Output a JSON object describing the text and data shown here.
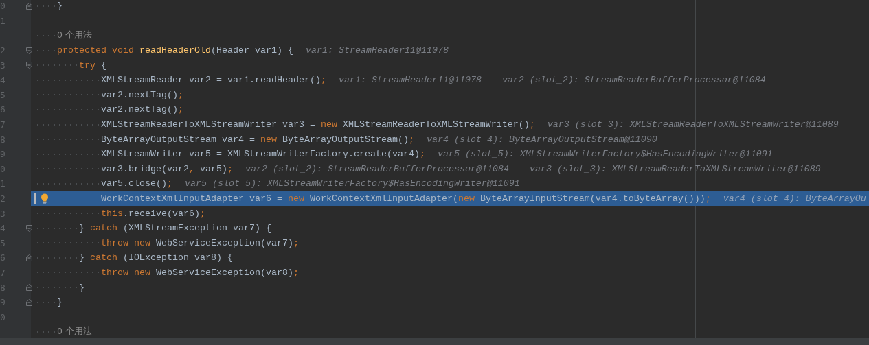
{
  "editor": {
    "rows": [
      {
        "kind": "code",
        "line_number": "0",
        "folding": {
          "kind": "end"
        },
        "current": false,
        "bulb": false,
        "indent": "    ",
        "tokens": [
          {
            "kind": "plain",
            "text": "}"
          }
        ]
      },
      {
        "kind": "code",
        "line_number": "1",
        "current": false,
        "bulb": false
      },
      {
        "kind": "usage_hint",
        "indent": "    ",
        "text": "0 个用法"
      },
      {
        "kind": "code",
        "line_number": "2",
        "folding": {
          "kind": "start"
        },
        "current": false,
        "bulb": false,
        "indent": "    ",
        "tokens": [
          {
            "kind": "keyword",
            "text": "protected"
          },
          {
            "kind": "keyword",
            "text": " void"
          },
          {
            "kind": "method",
            "text": " readHeaderOld"
          },
          {
            "kind": "plain",
            "text": "(Header var1) {"
          }
        ],
        "hints": [
          "var1: StreamHeader11@11078"
        ]
      },
      {
        "kind": "code",
        "line_number": "3",
        "folding": {
          "kind": "start"
        },
        "current": false,
        "bulb": false,
        "indent": "        ",
        "tokens": [
          {
            "kind": "keyword",
            "text": "try"
          },
          {
            "kind": "plain",
            "text": " {"
          }
        ]
      },
      {
        "kind": "code",
        "line_number": "4",
        "current": false,
        "bulb": false,
        "indent": "            ",
        "tokens": [
          {
            "kind": "plain",
            "text": "XMLStreamReader var2 = var1.readHeader()"
          },
          {
            "kind": "punct",
            "text": ";"
          }
        ],
        "hints": [
          "var1: StreamHeader11@11078",
          "var2 (slot_2): StreamReaderBufferProcessor@11084"
        ]
      },
      {
        "kind": "code",
        "line_number": "5",
        "current": false,
        "bulb": false,
        "indent": "            ",
        "tokens": [
          {
            "kind": "plain",
            "text": "var2.nextTag()"
          },
          {
            "kind": "punct",
            "text": ";"
          }
        ]
      },
      {
        "kind": "code",
        "line_number": "6",
        "current": false,
        "bulb": false,
        "indent": "            ",
        "tokens": [
          {
            "kind": "plain",
            "text": "var2.nextTag()"
          },
          {
            "kind": "punct",
            "text": ";"
          }
        ]
      },
      {
        "kind": "code",
        "line_number": "7",
        "current": false,
        "bulb": false,
        "indent": "            ",
        "tokens": [
          {
            "kind": "plain",
            "text": "XMLStreamReaderToXMLStreamWriter var3 = "
          },
          {
            "kind": "keyword",
            "text": "new"
          },
          {
            "kind": "plain",
            "text": " XMLStreamReaderToXMLStreamWriter()"
          },
          {
            "kind": "punct",
            "text": ";"
          }
        ],
        "hints": [
          "var3 (slot_3): XMLStreamReaderToXMLStreamWriter@11089"
        ]
      },
      {
        "kind": "code",
        "line_number": "8",
        "current": false,
        "bulb": false,
        "indent": "            ",
        "tokens": [
          {
            "kind": "plain",
            "text": "ByteArrayOutputStream var4 = "
          },
          {
            "kind": "keyword",
            "text": "new"
          },
          {
            "kind": "plain",
            "text": " ByteArrayOutputStream()"
          },
          {
            "kind": "punct",
            "text": ";"
          }
        ],
        "hints": [
          "var4 (slot_4): ByteArrayOutputStream@11090"
        ]
      },
      {
        "kind": "code",
        "line_number": "9",
        "current": false,
        "bulb": false,
        "indent": "            ",
        "tokens": [
          {
            "kind": "plain",
            "text": "XMLStreamWriter var5 = XMLStreamWriterFactory.create(var4)"
          },
          {
            "kind": "punct",
            "text": ";"
          }
        ],
        "hints": [
          "var5 (slot_5): XMLStreamWriterFactory$HasEncodingWriter@11091"
        ]
      },
      {
        "kind": "code",
        "line_number": "0",
        "current": false,
        "bulb": false,
        "indent": "            ",
        "tokens": [
          {
            "kind": "plain",
            "text": "var3.bridge(var2"
          },
          {
            "kind": "punct",
            "text": ","
          },
          {
            "kind": "plain",
            "text": " var5)"
          },
          {
            "kind": "punct",
            "text": ";"
          }
        ],
        "hints": [
          "var2 (slot_2): StreamReaderBufferProcessor@11084",
          "var3 (slot_3): XMLStreamReaderToXMLStreamWriter@11089"
        ]
      },
      {
        "kind": "code",
        "line_number": "1",
        "current": false,
        "bulb": false,
        "indent": "            ",
        "tokens": [
          {
            "kind": "plain",
            "text": "var5.close()"
          },
          {
            "kind": "punct",
            "text": ";"
          }
        ],
        "hints": [
          "var5 (slot_5): XMLStreamWriterFactory$HasEncodingWriter@11091"
        ]
      },
      {
        "kind": "code",
        "line_number": "2",
        "current": true,
        "bulb": true,
        "indent": "            ",
        "tokens": [
          {
            "kind": "plain",
            "text": "WorkContextXmlInputAdapter var6 = "
          },
          {
            "kind": "keyword",
            "text": "new"
          },
          {
            "kind": "plain",
            "text": " WorkContextXmlInputAdapter("
          },
          {
            "kind": "keyword",
            "text": "new"
          },
          {
            "kind": "plain",
            "text": " ByteArrayInputStream(var4.toByteArray()))"
          },
          {
            "kind": "punct",
            "text": ";"
          }
        ],
        "hints": [
          "var4 (slot_4): ByteArrayOu"
        ]
      },
      {
        "kind": "code",
        "line_number": "3",
        "current": false,
        "bulb": false,
        "indent": "            ",
        "tokens": [
          {
            "kind": "keyword",
            "text": "this"
          },
          {
            "kind": "plain",
            "text": ".receive(var6)"
          },
          {
            "kind": "punct",
            "text": ";"
          }
        ]
      },
      {
        "kind": "code",
        "line_number": "4",
        "folding": {
          "kind": "start"
        },
        "current": false,
        "bulb": false,
        "indent": "        ",
        "tokens": [
          {
            "kind": "plain",
            "text": "} "
          },
          {
            "kind": "keyword",
            "text": "catch"
          },
          {
            "kind": "plain",
            "text": " (XMLStreamException var7) {"
          }
        ]
      },
      {
        "kind": "code",
        "line_number": "5",
        "current": false,
        "bulb": false,
        "indent": "            ",
        "tokens": [
          {
            "kind": "keyword",
            "text": "throw"
          },
          {
            "kind": "keyword",
            "text": " new"
          },
          {
            "kind": "plain",
            "text": " WebServiceException(var7)"
          },
          {
            "kind": "punct",
            "text": ";"
          }
        ]
      },
      {
        "kind": "code",
        "line_number": "6",
        "folding": {
          "kind": "end"
        },
        "current": false,
        "bulb": false,
        "indent": "        ",
        "tokens": [
          {
            "kind": "plain",
            "text": "} "
          },
          {
            "kind": "keyword",
            "text": "catch"
          },
          {
            "kind": "plain",
            "text": " (IOException var8) {"
          }
        ]
      },
      {
        "kind": "code",
        "line_number": "7",
        "current": false,
        "bulb": false,
        "indent": "            ",
        "tokens": [
          {
            "kind": "keyword",
            "text": "throw"
          },
          {
            "kind": "keyword",
            "text": " new"
          },
          {
            "kind": "plain",
            "text": " WebServiceException(var8)"
          },
          {
            "kind": "punct",
            "text": ";"
          }
        ]
      },
      {
        "kind": "code",
        "line_number": "8",
        "folding": {
          "kind": "end"
        },
        "current": false,
        "bulb": false,
        "indent": "        ",
        "tokens": [
          {
            "kind": "plain",
            "text": "}"
          }
        ]
      },
      {
        "kind": "code",
        "line_number": "9",
        "folding": {
          "kind": "end"
        },
        "current": false,
        "bulb": false,
        "indent": "    ",
        "tokens": [
          {
            "kind": "plain",
            "text": "}"
          }
        ]
      },
      {
        "kind": "code",
        "line_number": "0",
        "current": false,
        "bulb": false
      },
      {
        "kind": "usage_hint",
        "indent": "    ",
        "text": "0 个用法"
      }
    ]
  }
}
